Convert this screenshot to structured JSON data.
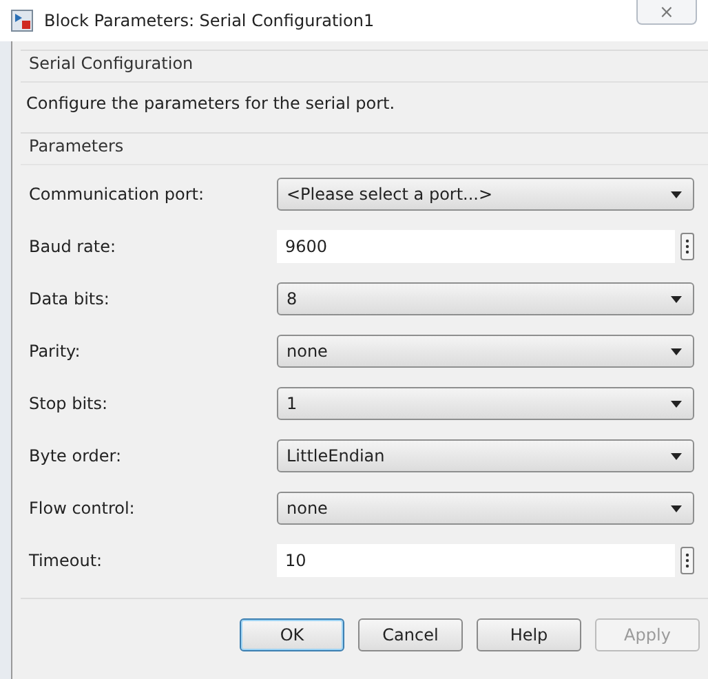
{
  "window": {
    "title": "Block Parameters: Serial Configuration1",
    "close": "⨯"
  },
  "description_group": {
    "title": "Serial Configuration",
    "text": "Configure the parameters for the serial port."
  },
  "parameters_group": {
    "title": "Parameters"
  },
  "parameters": [
    {
      "label": "Communication port:",
      "kind": "dropdown",
      "value": "<Please select a port...>"
    },
    {
      "label": "Baud rate:",
      "kind": "edit",
      "value": "9600"
    },
    {
      "label": "Data bits:",
      "kind": "dropdown",
      "value": "8"
    },
    {
      "label": "Parity:",
      "kind": "dropdown",
      "value": "none"
    },
    {
      "label": "Stop bits:",
      "kind": "dropdown",
      "value": "1"
    },
    {
      "label": "Byte order:",
      "kind": "dropdown",
      "value": "LittleEndian"
    },
    {
      "label": "Flow control:",
      "kind": "dropdown",
      "value": "none"
    },
    {
      "label": "Timeout:",
      "kind": "edit",
      "value": "10"
    }
  ],
  "buttons": [
    {
      "label": "OK",
      "default": true,
      "disabled": false
    },
    {
      "label": "Cancel",
      "default": false,
      "disabled": false
    },
    {
      "label": "Help",
      "default": false,
      "disabled": false
    },
    {
      "label": "Apply",
      "default": false,
      "disabled": true
    }
  ]
}
